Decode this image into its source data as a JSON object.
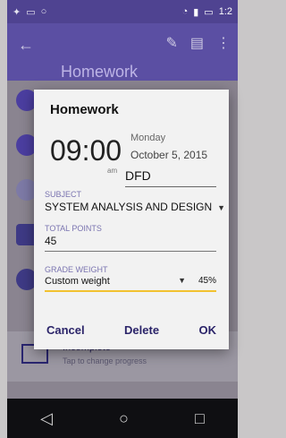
{
  "status_bar": {
    "time": "1:2"
  },
  "toolbar": {
    "title": "Homework"
  },
  "background": {
    "grade_fragment": "grade",
    "item_title": "Incomplete",
    "item_subtitle": "Tap to change progress"
  },
  "dialog": {
    "title": "Homework",
    "time": "09:00",
    "ampm": "am",
    "weekday": "Monday",
    "date": "October 5, 2015",
    "name_value": "DFD",
    "subject_label": "SUBJECT",
    "subject_value": "SYSTEM ANALYSIS AND DESIGN",
    "points_label": "TOTAL POINTS",
    "points_value": "45",
    "weight_label": "GRADE WEIGHT",
    "weight_value": "Custom weight",
    "weight_percent": "45%",
    "buttons": {
      "cancel": "Cancel",
      "delete": "Delete",
      "ok": "OK"
    }
  },
  "colors": {
    "primary": "#5b4fa3",
    "accent": "#f2c230"
  },
  "icons": [
    "back-arrow-icon",
    "edit-icon",
    "save-icon",
    "more-icon",
    "back-nav-icon",
    "home-nav-icon",
    "recents-nav-icon"
  ]
}
